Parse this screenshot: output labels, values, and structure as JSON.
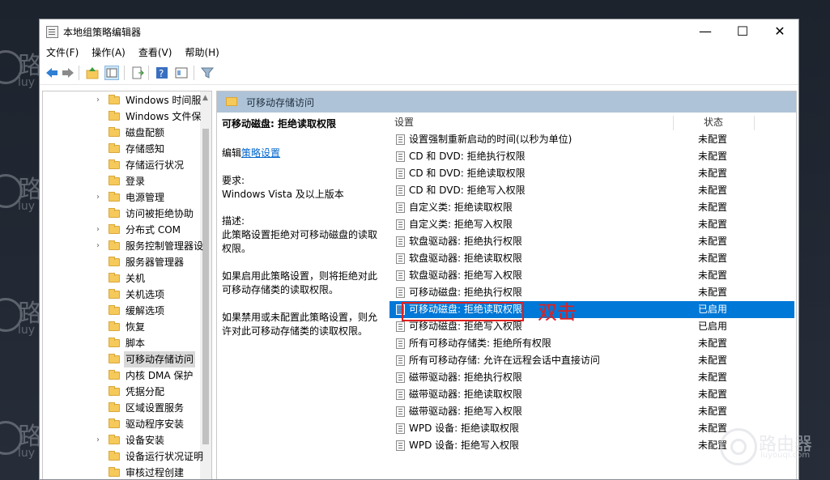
{
  "watermark": {
    "zh": "路",
    "en": "luy",
    "logo_zh": "路由器",
    "logo_en": "luyouqi.com"
  },
  "window": {
    "title": "本地组策略编辑器",
    "min": "—",
    "max": "☐",
    "close": "✕"
  },
  "menu": [
    "文件(F)",
    "操作(A)",
    "查看(V)",
    "帮助(H)"
  ],
  "tree": [
    {
      "label": "Windows 时间服",
      "expander": true
    },
    {
      "label": "Windows 文件保",
      "expander": false
    },
    {
      "label": "磁盘配额",
      "expander": false
    },
    {
      "label": "存储感知",
      "expander": false
    },
    {
      "label": "存储运行状况",
      "expander": false
    },
    {
      "label": "登录",
      "expander": false
    },
    {
      "label": "电源管理",
      "expander": true
    },
    {
      "label": "访问被拒绝协助",
      "expander": false
    },
    {
      "label": "分布式 COM",
      "expander": true
    },
    {
      "label": "服务控制管理器设",
      "expander": true
    },
    {
      "label": "服务器管理器",
      "expander": false
    },
    {
      "label": "关机",
      "expander": false
    },
    {
      "label": "关机选项",
      "expander": false
    },
    {
      "label": "缓解选项",
      "expander": false
    },
    {
      "label": "恢复",
      "expander": false
    },
    {
      "label": "脚本",
      "expander": false
    },
    {
      "label": "可移动存储访问",
      "expander": false,
      "selected": true
    },
    {
      "label": "内核 DMA 保护",
      "expander": false
    },
    {
      "label": "凭据分配",
      "expander": false
    },
    {
      "label": "区域设置服务",
      "expander": false
    },
    {
      "label": "驱动程序安装",
      "expander": false
    },
    {
      "label": "设备安装",
      "expander": true
    },
    {
      "label": "设备运行状况证明",
      "expander": false
    },
    {
      "label": "审核过程创建",
      "expander": false
    }
  ],
  "pane": {
    "header": "可移动存储访问",
    "policy_title": "可移动磁盘: 拒绝读取权限",
    "edit_prefix": "编辑",
    "edit_link": "策略设置",
    "req_label": "要求:",
    "req_text": "Windows Vista 及以上版本",
    "desc_label": "描述:",
    "desc1": "此策略设置拒绝对可移动磁盘的读取权限。",
    "desc2": "如果启用此策略设置，则将拒绝对此可移动存储类的读取权限。",
    "desc3": "如果禁用或未配置此策略设置，则允许对此可移动存储类的读取权限。"
  },
  "columns": {
    "setting": "设置",
    "state": "状态"
  },
  "rows": [
    {
      "name": "设置强制重新启动的时间(以秒为单位)",
      "state": "未配置"
    },
    {
      "name": "CD 和 DVD: 拒绝执行权限",
      "state": "未配置"
    },
    {
      "name": "CD 和 DVD: 拒绝读取权限",
      "state": "未配置"
    },
    {
      "name": "CD 和 DVD: 拒绝写入权限",
      "state": "未配置"
    },
    {
      "name": "自定义类: 拒绝读取权限",
      "state": "未配置"
    },
    {
      "name": "自定义类: 拒绝写入权限",
      "state": "未配置"
    },
    {
      "name": "软盘驱动器: 拒绝执行权限",
      "state": "未配置"
    },
    {
      "name": "软盘驱动器: 拒绝读取权限",
      "state": "未配置"
    },
    {
      "name": "软盘驱动器: 拒绝写入权限",
      "state": "未配置"
    },
    {
      "name": "可移动磁盘: 拒绝执行权限",
      "state": "未配置"
    },
    {
      "name": "可移动磁盘: 拒绝读取权限",
      "state": "已启用",
      "selected": true
    },
    {
      "name": "可移动磁盘: 拒绝写入权限",
      "state": "已启用"
    },
    {
      "name": "所有可移动存储类: 拒绝所有权限",
      "state": "未配置"
    },
    {
      "name": "所有可移动存储: 允许在远程会话中直接访问",
      "state": "未配置"
    },
    {
      "name": "磁带驱动器: 拒绝执行权限",
      "state": "未配置"
    },
    {
      "name": "磁带驱动器: 拒绝读取权限",
      "state": "未配置"
    },
    {
      "name": "磁带驱动器: 拒绝写入权限",
      "state": "未配置"
    },
    {
      "name": "WPD 设备: 拒绝读取权限",
      "state": "未配置"
    },
    {
      "name": "WPD 设备: 拒绝写入权限",
      "state": "未配置"
    }
  ],
  "annotation": "双击",
  "colors": {
    "selection": "#0078d7",
    "header": "#aec3d8",
    "annotation": "#e02020",
    "folder": "#f6c95b"
  }
}
